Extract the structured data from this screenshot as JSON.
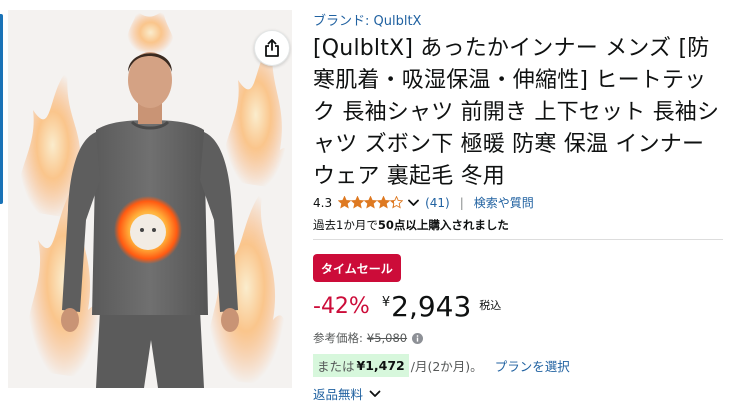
{
  "brand": {
    "label": "ブランド: QulbltX"
  },
  "product": {
    "title": "[QulbltX] あったかインナー メンズ [防寒肌着・吸湿保温・伸縮性] ヒートテック 長袖シャツ 前開き 上下セット 長袖シャツ ズボン下 極暖 防寒 保温 インナーウェア 裏起毛 冬用"
  },
  "rating": {
    "value": "4.3",
    "stars": 4.3,
    "count": "(41)",
    "separator": "|",
    "search_link": "検索や質問"
  },
  "bought": {
    "prefix": "過去1か月で",
    "highlight": "50点以上購入されました"
  },
  "deal": {
    "badge": "タイムセール",
    "badge_color": "#cc0c39"
  },
  "price": {
    "discount": "-42%",
    "currency": "¥",
    "amount": "2,943",
    "tax_note": "税込"
  },
  "reference": {
    "label": "参考価格:",
    "price": "¥5,080"
  },
  "plan": {
    "prefix": "または",
    "amount": "¥1,472",
    "term": "/月(2か月)。",
    "link": "プランを選択"
  },
  "returns": {
    "label": "返品無料"
  },
  "icons": {
    "share": "share-icon",
    "star": "star-icon",
    "chevron": "chevron-down-icon",
    "info": "info-icon"
  },
  "colors": {
    "link": "#2162a1",
    "deal": "#cc0c39",
    "star": "#de7921",
    "plan_highlight": "#d7f7dc"
  }
}
